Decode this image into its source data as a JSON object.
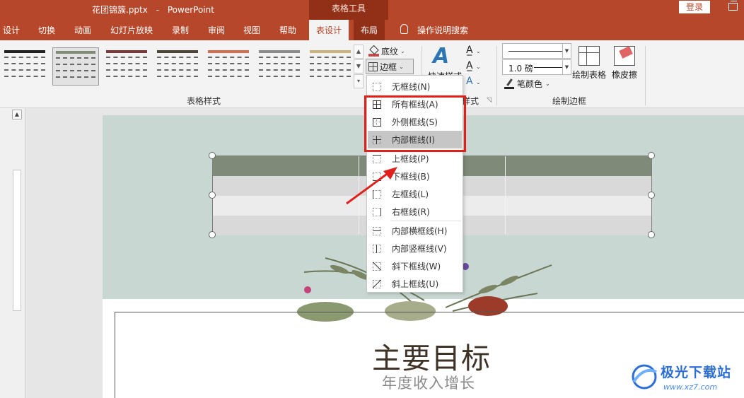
{
  "window": {
    "file_name": "花团锦簇.pptx",
    "app_name": "PowerPoint",
    "context_tab_group": "表格工具",
    "login_label": "登录"
  },
  "tabs": [
    {
      "label": "设计"
    },
    {
      "label": "切换"
    },
    {
      "label": "动画"
    },
    {
      "label": "幻灯片放映"
    },
    {
      "label": "录制"
    },
    {
      "label": "审阅"
    },
    {
      "label": "视图"
    },
    {
      "label": "帮助"
    },
    {
      "label": "表设计"
    },
    {
      "label": "布局"
    },
    {
      "label": "操作说明搜索"
    }
  ],
  "ribbon": {
    "table_styles_label": "表格样式",
    "shading_label": "底纹",
    "borders_label": "边框",
    "quick_styles_label": "快速样式",
    "wordart_group_label": "样式",
    "pen_weight": "1.0 磅",
    "pen_color_label": "笔颜色",
    "draw_table_label": "绘制表格",
    "eraser_label": "橡皮擦",
    "draw_borders_label": "绘制边框",
    "style_colors": [
      "#222222",
      "#7f8a78",
      "#7a3b3b",
      "#4b4438",
      "#d36d52",
      "#8c8c8c",
      "#c7b27e"
    ]
  },
  "border_menu": {
    "items": [
      {
        "label": "无框线(N)"
      },
      {
        "label": "所有框线(A)"
      },
      {
        "label": "外侧框线(S)"
      },
      {
        "label": "内部框线(I)"
      },
      {
        "label": "上框线(P)"
      },
      {
        "label": "下框线(B)"
      },
      {
        "label": "左框线(L)"
      },
      {
        "label": "右框线(R)"
      },
      {
        "label": "内部横框线(H)"
      },
      {
        "label": "内部竖框线(V)"
      },
      {
        "label": "斜下框线(W)"
      },
      {
        "label": "斜上框线(U)"
      }
    ],
    "highlighted": "内部框线(I)"
  },
  "slide": {
    "title": "主要目标",
    "subtitle": "年度收入增长",
    "table_header_color": "#7f8a78",
    "table_band_colors": [
      "#d9d9d9",
      "#ececec"
    ]
  },
  "watermark": {
    "name": "极光下载站",
    "url": "www.xz7.com"
  },
  "colors": {
    "accent": "#b7472a",
    "context_tab": "#922f17",
    "annotation_red": "#e0201c"
  }
}
